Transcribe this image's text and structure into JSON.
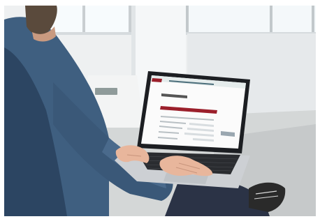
{
  "scene": {
    "subject": "person-typing-on-laptop",
    "setting": "bright-office-with-windows",
    "palette": {
      "wall": "#eef0f1",
      "window": "#f7fbfd",
      "floor": "#cfd2d2",
      "sweater": "#3f5f80",
      "sweater_shadow": "#2c4562",
      "skin": "#e8b69c",
      "jeans": "#2b3346",
      "laptop_body": "#cdd0d4",
      "laptop_bezel": "#1c1e22",
      "screen_bg": "#fbfbfb",
      "accent_red": "#9b1f2b",
      "keyboard": "#2a2c30",
      "shoe": "#2a2a2a"
    }
  },
  "laptop_screen": {
    "app": "web-form",
    "header_accent": "#9b1f2b",
    "form_heading": "",
    "note": ""
  }
}
